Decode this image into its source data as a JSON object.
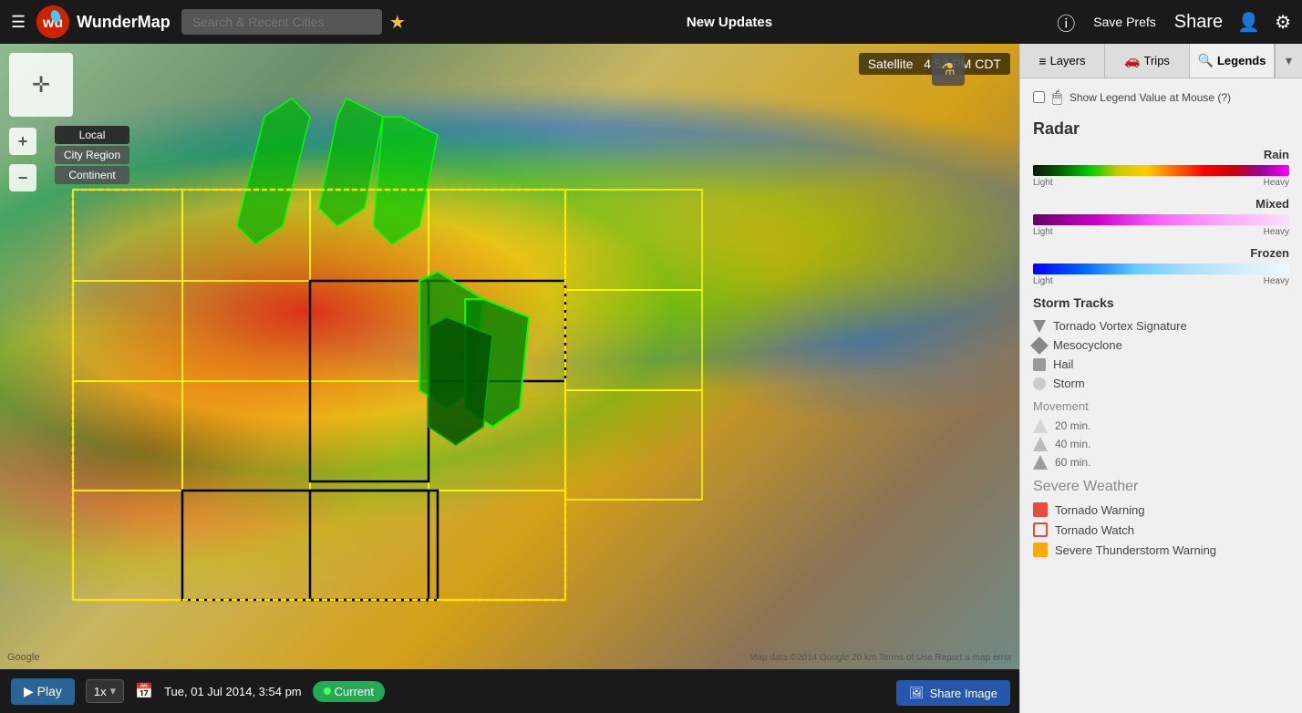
{
  "header": {
    "menu_icon": "☰",
    "logo_text": "wu",
    "app_title": "WunderMap",
    "search_placeholder": "Search & Recent Cities",
    "star_label": "★",
    "new_updates": "New Updates",
    "info_label": "ⓘ",
    "save_prefs_label": "Save Prefs",
    "share_label": "Share",
    "profile_label": "👤",
    "settings_label": "⚙"
  },
  "map": {
    "satellite_label": "Satellite",
    "time_label": "4:53 PM CDT",
    "google_watermark": "Google",
    "map_data": "Map data ©2014 Google   20 km   Terms of Use   Report a map error"
  },
  "region_buttons": {
    "local_label": "Local",
    "city_region_label": "City Region",
    "continent_label": "Continent"
  },
  "bottom_bar": {
    "play_label": "▶ Play",
    "speed_label": "1x",
    "date_time": "Tue, 01 Jul 2014, 3:54 pm",
    "current_label": "Current"
  },
  "share_image_btn": "Share Image",
  "legends_legend_btn": "Legends",
  "panel": {
    "tabs": [
      {
        "id": "layers",
        "icon": "≡",
        "label": "Layers"
      },
      {
        "id": "trips",
        "icon": "🚗",
        "label": "Trips"
      },
      {
        "id": "legends",
        "icon": "🔍",
        "label": "Legends"
      }
    ],
    "show_legend_label": "Show Legend Value at Mouse (?)",
    "radar_title": "Radar",
    "rain_label": "Rain",
    "rain_light": "Light",
    "rain_heavy": "Heavy",
    "mixed_label": "Mixed",
    "mixed_light": "Light",
    "mixed_heavy": "Heavy",
    "frozen_label": "Frozen",
    "frozen_light": "Light",
    "frozen_heavy": "Heavy",
    "storm_tracks_title": "Storm Tracks",
    "storm_track_items": [
      {
        "icon": "tvs",
        "label": "Tornado Vortex Signature"
      },
      {
        "icon": "meso",
        "label": "Mesocyclone"
      },
      {
        "icon": "hail",
        "label": "Hail"
      },
      {
        "icon": "storm",
        "label": "Storm"
      }
    ],
    "movement_title": "Movement",
    "movement_items": [
      {
        "label": "20 min.",
        "class": "m20"
      },
      {
        "label": "40 min.",
        "class": "m40"
      },
      {
        "label": "60 min.",
        "class": "m60"
      }
    ],
    "severe_weather_title": "Severe Weather",
    "severe_items": [
      {
        "swatch": "swatch-tw-warning",
        "label": "Tornado Warning"
      },
      {
        "swatch": "swatch-tw-watch",
        "label": "Tornado Watch"
      },
      {
        "label": "Severe Thunderstorm Warning"
      }
    ]
  }
}
